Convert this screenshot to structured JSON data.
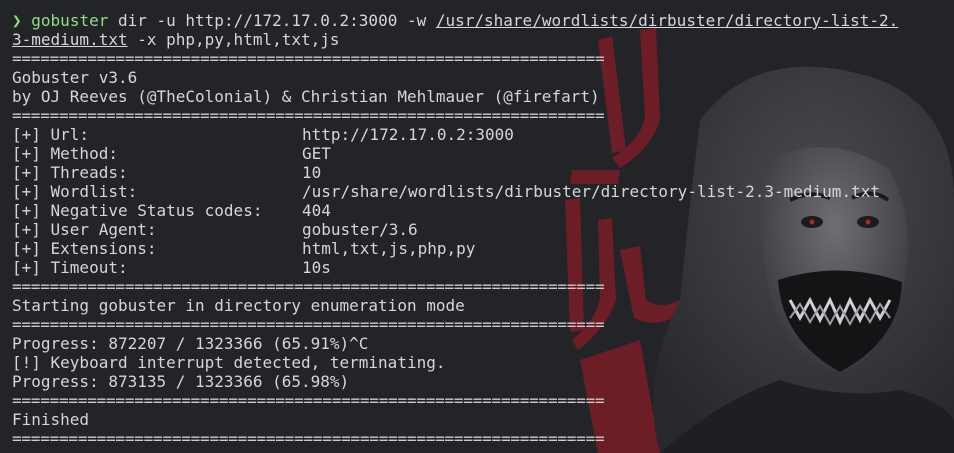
{
  "colors": {
    "background": "#232427",
    "prompt_green": "#8ee07f",
    "text": "#d4d6da",
    "accent_red": "#8c1f2a"
  },
  "command": {
    "prompt_icon": "❯",
    "program": "gobuster",
    "args_before_path": " dir -u http://172.17.0.2:3000 -w ",
    "wordlist_path_line1": "/usr/share/wordlists/dirbuster/directory-list-2.",
    "wordlist_path_line2": "3-medium.txt",
    "args_after_path": " -x php,py,html,txt,js"
  },
  "separator": "===============================================================",
  "banner": {
    "title": "Gobuster v3.6",
    "authors": "by OJ Reeves (@TheColonial) & Christian Mehlmauer (@firefart)"
  },
  "config": [
    {
      "key": "[+] Url:",
      "value": "http://172.17.0.2:3000"
    },
    {
      "key": "[+] Method:",
      "value": "GET"
    },
    {
      "key": "[+] Threads:",
      "value": "10"
    },
    {
      "key": "[+] Wordlist:",
      "value": "/usr/share/wordlists/dirbuster/directory-list-2.3-medium.txt"
    },
    {
      "key": "[+] Negative Status codes:",
      "value": "404"
    },
    {
      "key": "[+] User Agent:",
      "value": "gobuster/3.6"
    },
    {
      "key": "[+] Extensions:",
      "value": "html,txt,js,php,py"
    },
    {
      "key": "[+] Timeout:",
      "value": "10s"
    }
  ],
  "status": {
    "starting": "Starting gobuster in directory enumeration mode",
    "progress_interrupted": "Progress: 872207 / 1323366 (65.91%)^C",
    "interrupt_notice": "[!] Keyboard interrupt detected, terminating.",
    "progress_final": "Progress: 873135 / 1323366 (65.98%)",
    "finished": "Finished"
  }
}
